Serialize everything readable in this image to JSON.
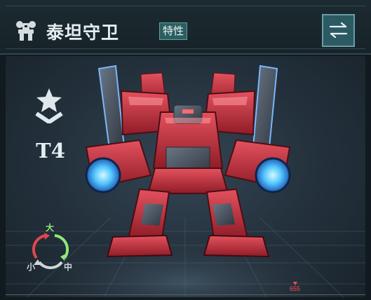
{
  "header": {
    "unit_icon": "mech-unit-icon",
    "title": "泰坦守卫",
    "trait_label": "特性",
    "swap_icon": "swap-arrows-icon"
  },
  "rank": {
    "icon": "rank-star-chevron-icon",
    "tier": "T4"
  },
  "size_cycle": {
    "icon": "size-cycle-icon",
    "big": "大",
    "mid": "中",
    "small": "小"
  },
  "timeline": {
    "value": "655"
  },
  "colors": {
    "trait_bg": "#2c5e61",
    "swap_bg": "#2c5a63",
    "accent_red": "#ff4c4c",
    "cycle_green": "#8ee879",
    "cycle_red": "#e0474e"
  }
}
